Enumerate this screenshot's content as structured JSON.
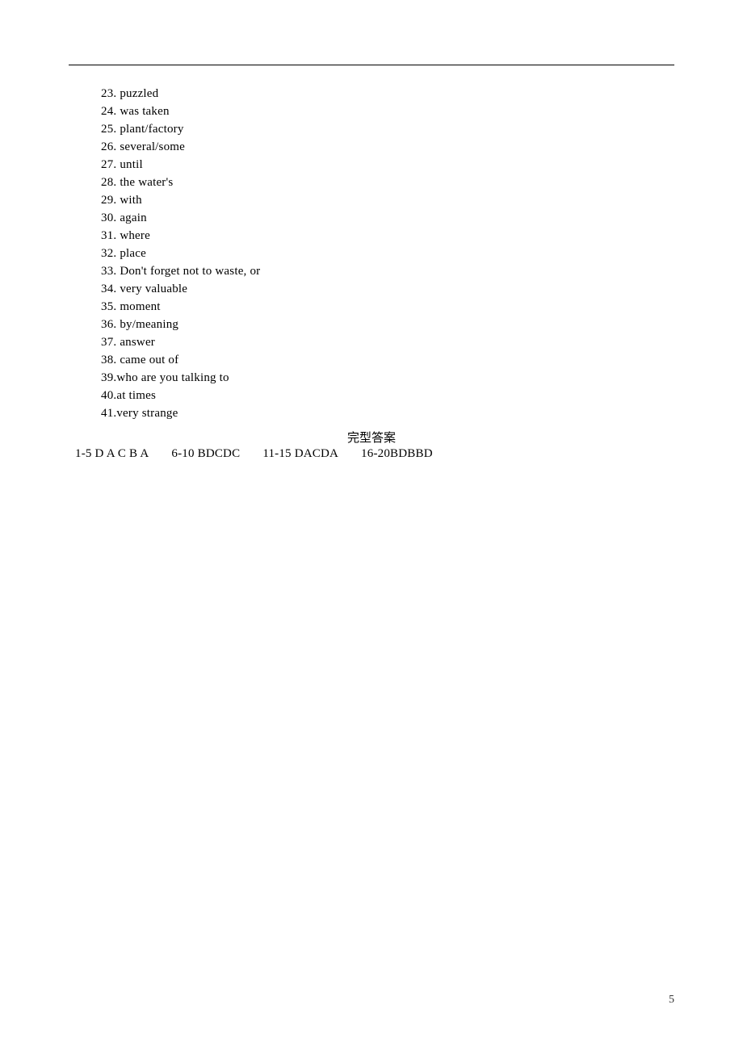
{
  "answers": {
    "items": [
      {
        "num": "23.",
        "text": "puzzled"
      },
      {
        "num": "24.",
        "text": "was taken"
      },
      {
        "num": "25.",
        "text": "plant/factory"
      },
      {
        "num": "26.",
        "text": "several/some"
      },
      {
        "num": "27.",
        "text": "until"
      },
      {
        "num": "28.",
        "text": "the water's"
      },
      {
        "num": "29.",
        "text": "with"
      },
      {
        "num": "30.",
        "text": "again"
      },
      {
        "num": "31.",
        "text": "where"
      },
      {
        "num": "32.",
        "text": "place"
      },
      {
        "num": "33.",
        "text": "Don't forget not to waste, or"
      },
      {
        "num": "34.",
        "text": "very valuable"
      },
      {
        "num": "35.",
        "text": "moment"
      },
      {
        "num": "36.",
        "text": "by/meaning"
      },
      {
        "num": "37.",
        "text": "answer"
      },
      {
        "num": "38.",
        "text": "came out of"
      },
      {
        "num": "39.",
        "text": "who are you talking to",
        "nospace": true
      },
      {
        "num": "40.",
        "text": "at times",
        "nospace": true
      },
      {
        "num": "41.",
        "text": "very strange",
        "nospace": true
      }
    ]
  },
  "cloze": {
    "title": "完型答案",
    "segments": [
      "1-5  D A C B A",
      "6-10  BDCDC",
      "11-15  DACDA",
      "16-20BDBBD"
    ]
  },
  "page_number": "5"
}
